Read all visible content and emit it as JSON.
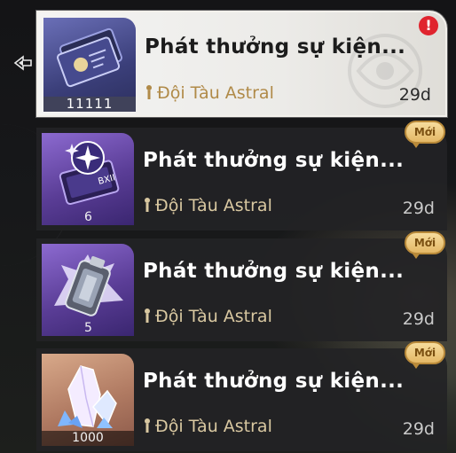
{
  "mail_list": {
    "items": [
      {
        "title": "Phát thưởng sự kiện...",
        "sender": "Đội Tàu Astral",
        "days_left": "29d",
        "quantity": "11111",
        "icon": "pass-ticket-icon",
        "selected": true,
        "alert_label": "!",
        "new_label": null
      },
      {
        "title": "Phát thưởng sự kiện...",
        "sender": "Đội Tàu Astral",
        "days_left": "29d",
        "quantity": "6",
        "icon": "star-rail-pass-icon",
        "selected": false,
        "new_label": "Mới"
      },
      {
        "title": "Phát thưởng sự kiện...",
        "sender": "Đội Tàu Astral",
        "days_left": "29d",
        "quantity": "5",
        "icon": "fuel-canister-icon",
        "selected": false,
        "new_label": "Mới"
      },
      {
        "title": "Phát thưởng sự kiện...",
        "sender": "Đội Tàu Astral",
        "days_left": "29d",
        "quantity": "1000",
        "icon": "crystal-icon",
        "selected": false,
        "new_label": "Mới"
      }
    ]
  },
  "colors": {
    "sender_gold": "#d9c8a1",
    "alert_red": "#e0242e",
    "badge_gold": "#e4b866"
  }
}
